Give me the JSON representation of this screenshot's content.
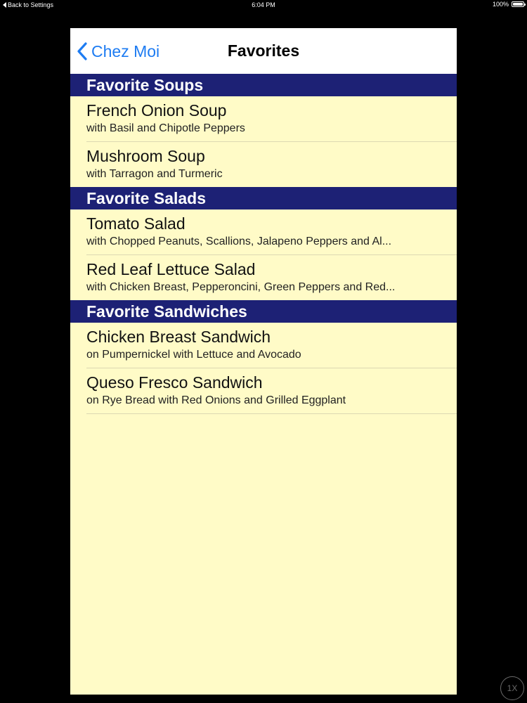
{
  "status_bar": {
    "back_label": "Back to Settings",
    "time": "6:04 PM",
    "battery": "100%",
    "battery_level": 1.0
  },
  "nav": {
    "back_label": "Chez Moi",
    "title": "Favorites"
  },
  "sections": [
    {
      "header": "Favorite Soups",
      "items": [
        {
          "title": "French Onion Soup",
          "subtitle": "with Basil and Chipotle Peppers"
        },
        {
          "title": "Mushroom Soup",
          "subtitle": "with Tarragon and Turmeric"
        }
      ]
    },
    {
      "header": "Favorite Salads",
      "items": [
        {
          "title": "Tomato Salad",
          "subtitle": "with Chopped Peanuts, Scallions, Jalapeno Peppers and Al..."
        },
        {
          "title": "Red Leaf Lettuce Salad",
          "subtitle": "with Chicken Breast, Pepperoncini, Green Peppers and Red..."
        }
      ]
    },
    {
      "header": "Favorite Sandwiches",
      "items": [
        {
          "title": "Chicken Breast Sandwich",
          "subtitle": "on Pumpernickel with Lettuce and Avocado"
        },
        {
          "title": "Queso Fresco Sandwich",
          "subtitle": "on Rye Bread with Red Onions and Grilled Eggplant"
        }
      ]
    }
  ],
  "zoom_badge": "1X",
  "colors": {
    "header_bg": "#1d2175",
    "list_bg": "#fffbc7",
    "accent": "#1e7cf2"
  }
}
